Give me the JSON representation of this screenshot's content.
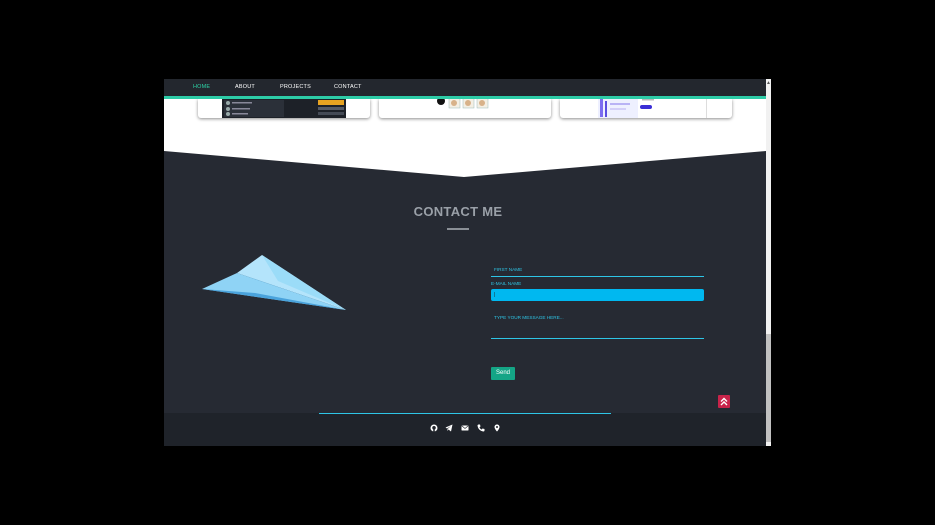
{
  "nav": {
    "items": [
      {
        "label": "HOME",
        "active": true
      },
      {
        "label": "ABOUT",
        "active": false
      },
      {
        "label": "PROJECTS",
        "active": false
      },
      {
        "label": "CONTACT",
        "active": false
      }
    ]
  },
  "contact": {
    "title": "CONTACT ME",
    "first_name_placeholder": "FIRST NAME",
    "email_label": "E-MAIL NAME",
    "email_value": "|",
    "message_placeholder": "TYPE YOUR MESSAGE HERE...",
    "send_label": "Send"
  },
  "footer": {
    "icons": [
      "github-icon",
      "telegram-icon",
      "email-icon",
      "phone-icon",
      "location-icon"
    ]
  },
  "colors": {
    "accent_green": "#2dcca7",
    "accent_cyan": "#2ec5e6",
    "background_dark": "#262a33",
    "send_button": "#14a586",
    "scroll_top": "#c8234a"
  }
}
